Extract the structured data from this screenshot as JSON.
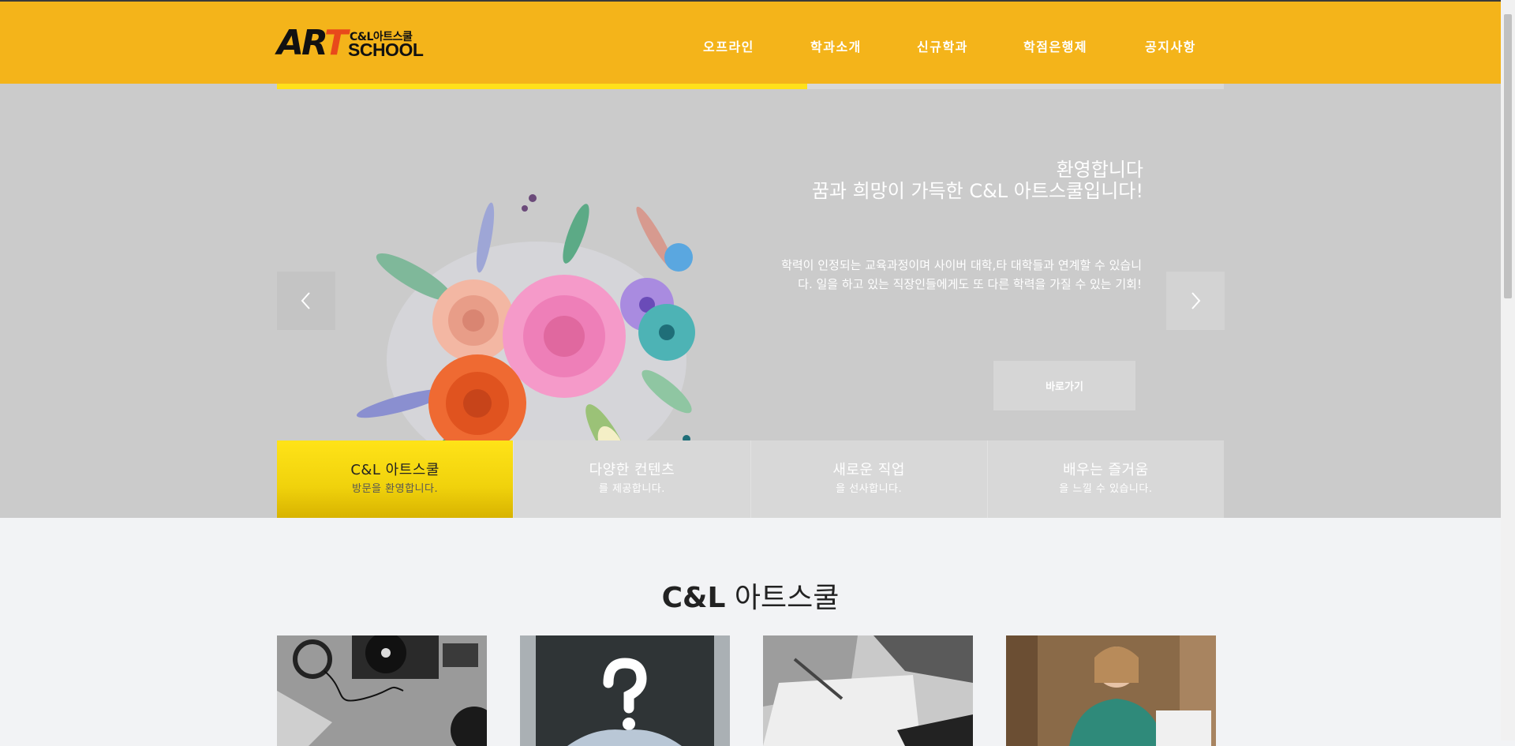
{
  "header": {
    "logo": {
      "art_text": "AR",
      "art_highlight": "T",
      "small_text": "C&L아트스쿨",
      "school_text": "SCHOOL"
    },
    "nav": [
      {
        "label": "오프라인"
      },
      {
        "label": "학과소개"
      },
      {
        "label": "신규학과"
      },
      {
        "label": "학점은행제"
      },
      {
        "label": "공지사항"
      }
    ]
  },
  "hero": {
    "progress": 0.56,
    "title_line1": "환영합니다",
    "title_line2": "꿈과 희망이 가득한 C&L 아트스쿨입니다!",
    "description": "학력이 인정되는 교육과정이며 사이버 대학,타 대학들과 연계할 수 있습니다. 일을 하고 있는 직장인들에게도 또 다른 학력을 가질 수 있는 기회!",
    "cta_label": "바로가기",
    "prev_icon": "chevron-left-icon",
    "next_icon": "chevron-right-icon",
    "tabs": [
      {
        "title": "C&L 아트스쿨",
        "subtitle": "방문을 환영합니다.",
        "active": true
      },
      {
        "title": "다양한 컨텐츠",
        "subtitle": "를 제공합니다.",
        "active": false
      },
      {
        "title": "새로운 직업",
        "subtitle": "을 선사합니다.",
        "active": false
      },
      {
        "title": "배우는 즐거움",
        "subtitle": "을 느낄 수 있습니다.",
        "active": false
      }
    ]
  },
  "section": {
    "title_bold": "C&L",
    "title_rest": " 아트스쿨",
    "cards": [
      {
        "image": "turntable-headphones-photo"
      },
      {
        "image": "question-mark-photo"
      },
      {
        "image": "notebook-pen-laptop-photo"
      },
      {
        "image": "student-with-books-photo"
      }
    ]
  },
  "colors": {
    "header_bg": "#f4b41a",
    "hero_bg": "#cbcbcb",
    "active_tab": "#ffe318",
    "page_bg": "#f2f3f5"
  }
}
